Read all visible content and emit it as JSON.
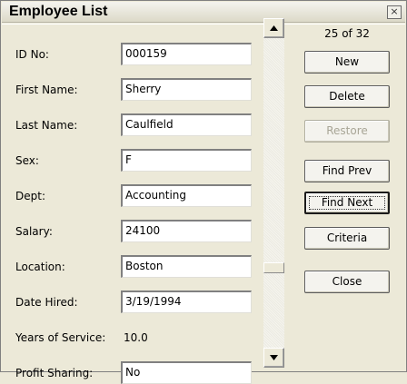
{
  "window": {
    "title": "Employee List",
    "close_glyph": "×"
  },
  "record_counter": "25 of 32",
  "fields": {
    "id_no": {
      "label": "ID No:",
      "value": "000159"
    },
    "first_name": {
      "label": "First Name:",
      "value": "Sherry"
    },
    "last_name": {
      "label": "Last Name:",
      "value": "Caulfield"
    },
    "sex": {
      "label": "Sex:",
      "value": "F"
    },
    "dept": {
      "label": "Dept:",
      "value": "Accounting"
    },
    "salary": {
      "label": "Salary:",
      "value": "24100"
    },
    "location": {
      "label": "Location:",
      "value": "Boston"
    },
    "date_hired": {
      "label": "Date Hired:",
      "value": "3/19/1994"
    },
    "years_of_service": {
      "label": "Years of Service:",
      "value": "10.0"
    },
    "profit_sharing": {
      "label": "Profit Sharing:",
      "value": "No"
    }
  },
  "buttons": {
    "new": "New",
    "delete": "Delete",
    "restore": "Restore",
    "find_prev": "Find Prev",
    "find_next": "Find Next",
    "criteria": "Criteria",
    "close": "Close"
  },
  "scroll": {
    "position_fraction": 0.75
  }
}
